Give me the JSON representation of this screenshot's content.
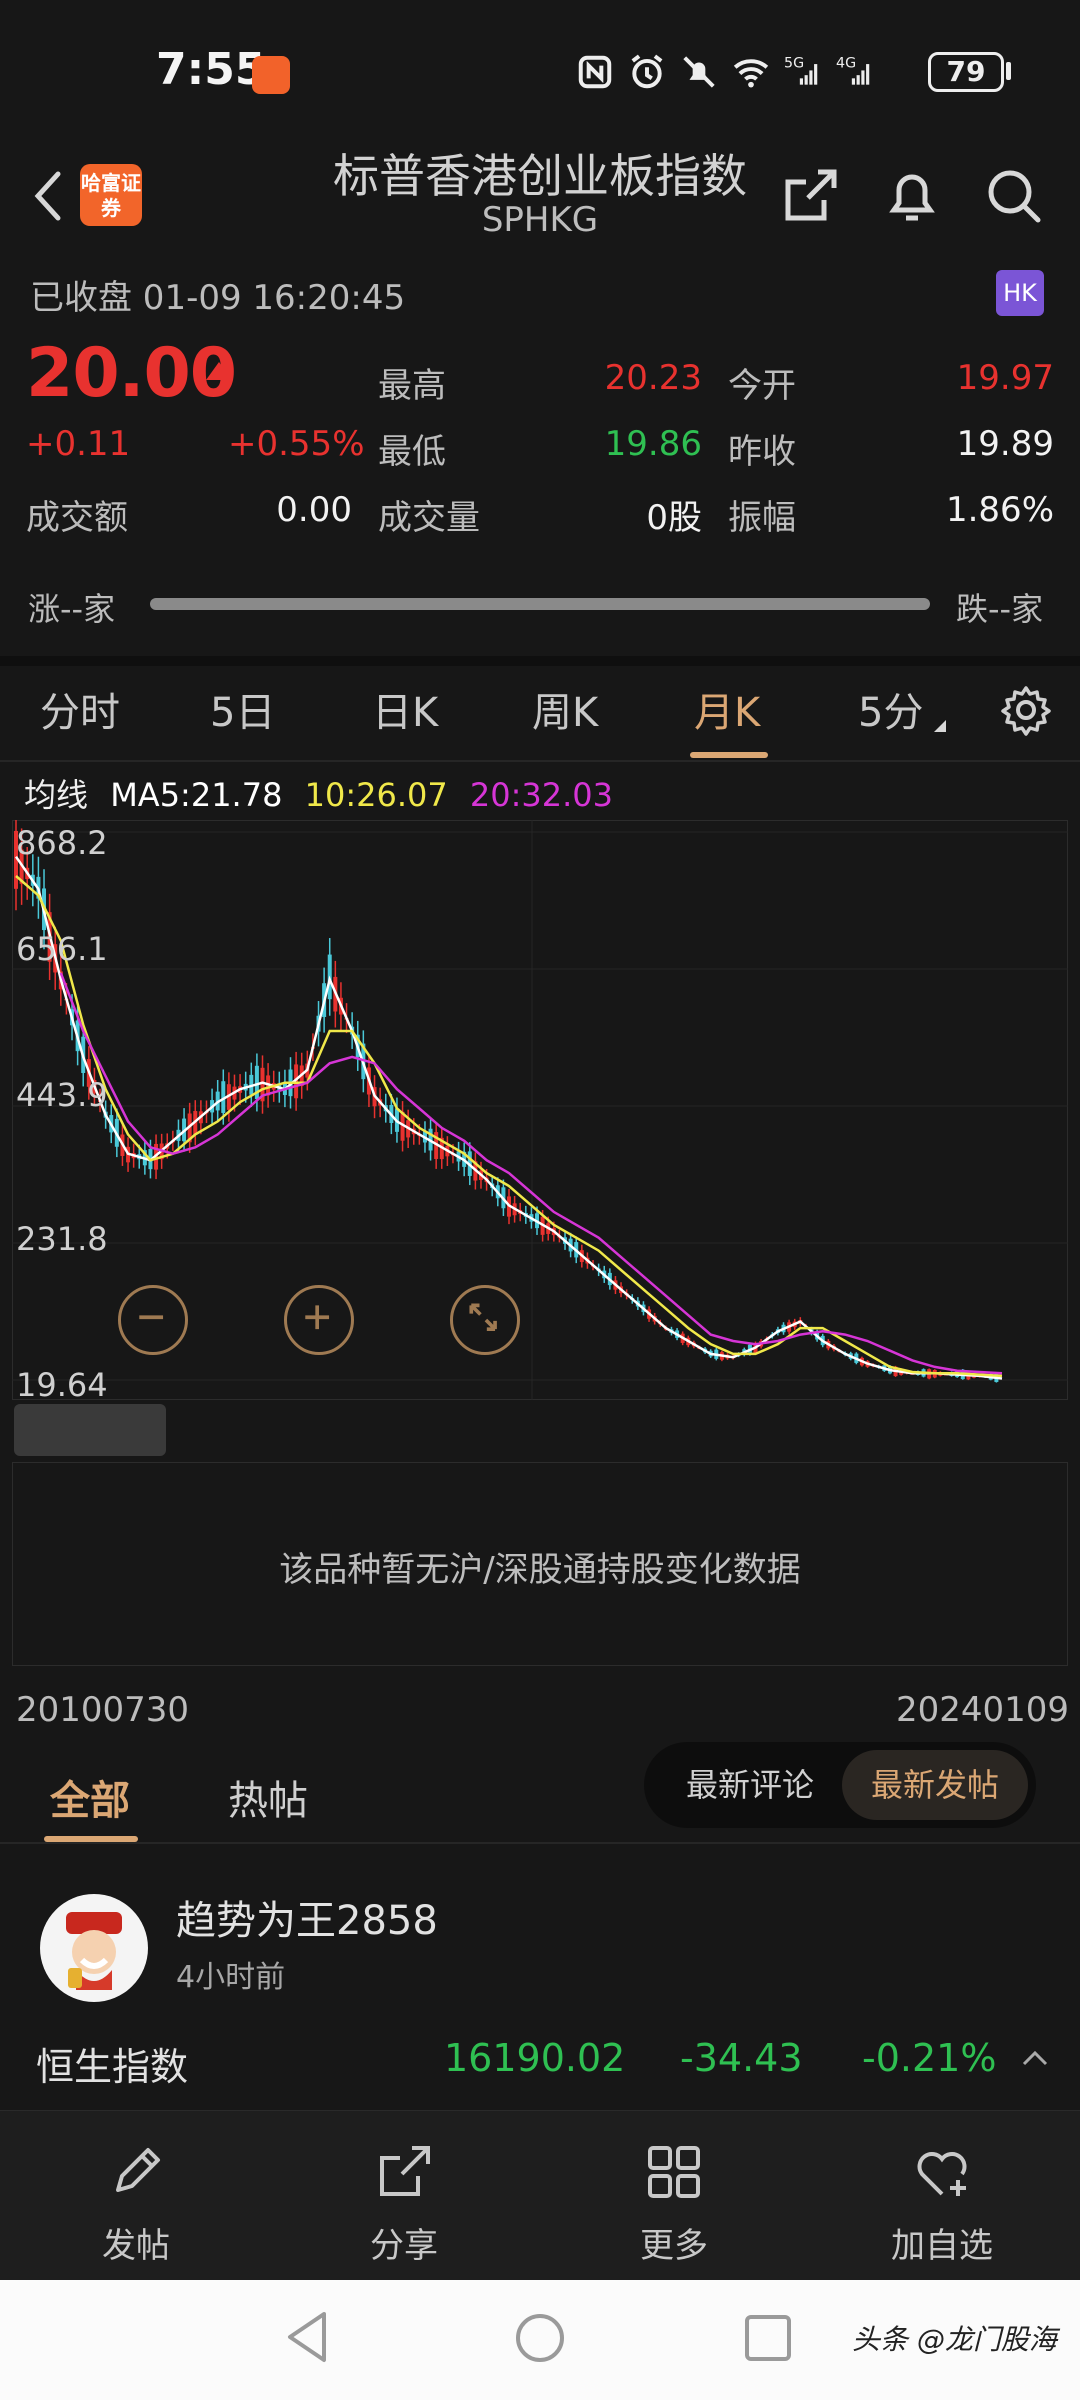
{
  "status_bar": {
    "time": "7:55",
    "battery": "79"
  },
  "header": {
    "title": "标普香港创业板指数",
    "subtitle": "SPHKG",
    "broker_logo": "哈富证券"
  },
  "quote": {
    "market_status": "已收盘 01-09 16:20:45",
    "market_badge": "HK",
    "price": "20.00",
    "change": "+0.11",
    "change_pct": "+0.55%",
    "fields": {
      "high_label": "最高",
      "high": "20.23",
      "open_label": "今开",
      "open": "19.97",
      "low_label": "最低",
      "low": "19.86",
      "prev_close_label": "昨收",
      "prev_close": "19.89",
      "turnover_label": "成交额",
      "turnover": "0.00",
      "volume_label": "成交量",
      "volume": "0股",
      "amplitude_label": "振幅",
      "amplitude": "1.86%"
    },
    "breadth": {
      "up": "涨--家",
      "down": "跌--家"
    }
  },
  "chart_tabs": [
    "分时",
    "5日",
    "日K",
    "周K",
    "月K",
    "5分"
  ],
  "active_chart_tab": "月K",
  "ma_legend": {
    "label": "均线",
    "ma5": "MA5:21.78",
    "ma10": "10:26.07",
    "ma20": "20:32.03"
  },
  "colors": {
    "up": "#e8322f",
    "down": "#2fc052",
    "accent": "#dba774",
    "ma5": "#ffffff",
    "ma10": "#f0e84a",
    "ma20": "#d635d6",
    "candle_down": "#4ac8d8"
  },
  "chart_data": {
    "type": "line",
    "title": "",
    "y_ticks": [
      "868.2",
      "656.1",
      "443.9",
      "231.8",
      "19.64"
    ],
    "ylim": [
      19.64,
      868.2
    ],
    "x_range": [
      "20100730",
      "20240109"
    ],
    "series": [
      {
        "name": "MA5",
        "values": [
          830,
          780,
          640,
          520,
          430,
          370,
          360,
          390,
          420,
          450,
          470,
          480,
          470,
          500,
          640,
          560,
          460,
          420,
          400,
          380,
          360,
          330,
          290,
          270,
          250,
          220,
          190,
          160,
          130,
          100,
          80,
          60,
          55,
          70,
          95,
          110,
          80,
          60,
          45,
          35,
          30,
          30,
          28,
          26,
          22
        ]
      },
      {
        "name": "MA10",
        "values": [
          800,
          770,
          700,
          570,
          470,
          400,
          360,
          370,
          400,
          420,
          450,
          470,
          480,
          480,
          560,
          560,
          510,
          440,
          410,
          390,
          370,
          340,
          320,
          290,
          260,
          240,
          220,
          190,
          160,
          130,
          100,
          75,
          60,
          60,
          75,
          100,
          100,
          80,
          60,
          40,
          32,
          30,
          30,
          28,
          26
        ]
      },
      {
        "name": "MA20",
        "values": [
          null,
          null,
          650,
          560,
          490,
          420,
          380,
          370,
          380,
          400,
          430,
          460,
          470,
          480,
          510,
          520,
          510,
          470,
          440,
          410,
          390,
          360,
          340,
          310,
          280,
          260,
          240,
          210,
          180,
          150,
          120,
          90,
          80,
          75,
          80,
          90,
          95,
          90,
          80,
          65,
          50,
          40,
          34,
          32,
          30
        ]
      }
    ],
    "annotations": [
      "该品种暂无沪/深股通持股变化数据"
    ]
  },
  "connect_msg": "该品种暂无沪/深股通持股变化数据",
  "date_range": {
    "start": "20100730",
    "end": "20240109"
  },
  "comments": {
    "tabs": [
      "全部",
      "热帖"
    ],
    "sort": [
      "最新评论",
      "最新发帖"
    ],
    "post": {
      "author": "趋势为王2858",
      "time": "4小时前"
    }
  },
  "ticker": {
    "name": "恒生指数",
    "price": "16190.02",
    "change": "-34.43",
    "pct": "-0.21%"
  },
  "actions": [
    "发帖",
    "分享",
    "更多",
    "加自选"
  ],
  "watermark": "头条 @龙门股海"
}
